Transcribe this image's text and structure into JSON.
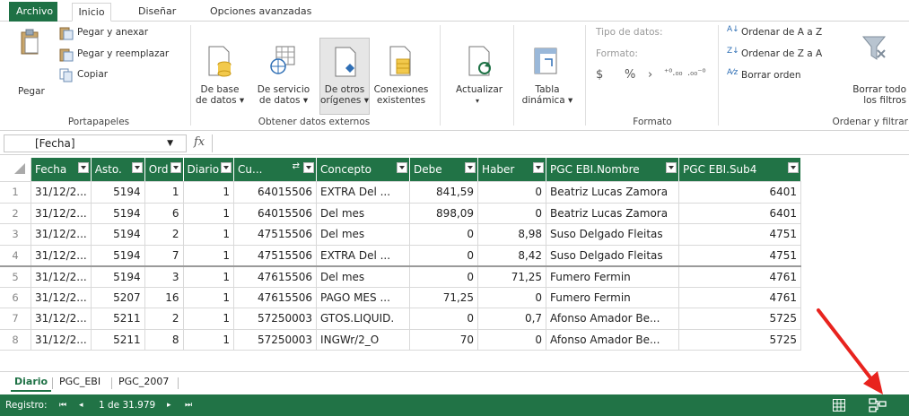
{
  "tabs": [
    "Archivo",
    "Inicio",
    "Diseñar",
    "Opciones avanzadas"
  ],
  "ribbon": {
    "clipboard": {
      "paste": "Pegar",
      "paste_append": "Pegar y anexar",
      "paste_replace": "Pegar y reemplazar",
      "copy": "Copiar",
      "group": "Portapapeles"
    },
    "external": {
      "from_db_1": "De base",
      "from_db_2": "de datos ▾",
      "from_service_1": "De servicio",
      "from_service_2": "de datos ▾",
      "from_other_1": "De otros",
      "from_other_2": "orígenes ▾",
      "existing_1": "Conexiones",
      "existing_2": "existentes",
      "group": "Obtener datos externos"
    },
    "refresh": {
      "label": "Actualizar",
      "caret": "▾"
    },
    "pivot": {
      "label_1": "Tabla",
      "label_2": "dinámica ▾"
    },
    "format": {
      "data_type": "Tipo de datos:",
      "format": "Formato:",
      "currency": "$",
      "percent": "%",
      "comma": "›",
      "dec_inc": "⁺⁰.₀₀",
      "dec_dec": ".₀₀⁻⁰",
      "group": "Formato"
    },
    "sort": {
      "asc": "Ordenar de A a Z",
      "desc": "Ordenar de Z a A",
      "clear": "Borrar orden",
      "clear_filters_1": "Borrar todo",
      "clear_filters_2": "los filtros",
      "group": "Ordenar y filtrar"
    }
  },
  "formula_bar": {
    "name_box": "[Fecha]",
    "fx": "fx"
  },
  "table": {
    "headers": [
      "Fecha",
      "Asto.",
      "Ord",
      "Diario",
      "Cu...",
      "Concepto",
      "Debe",
      "Haber",
      "PGC EBI.Nombre",
      "PGC EBI.Sub4"
    ],
    "rows": [
      [
        "1",
        "31/12/2...",
        "5194",
        "1",
        "1",
        "64015506",
        "EXTRA Del ...",
        "841,59",
        "0",
        "Beatriz Lucas Zamora",
        "6401"
      ],
      [
        "2",
        "31/12/2...",
        "5194",
        "6",
        "1",
        "64015506",
        "Del mes",
        "898,09",
        "0",
        "Beatriz Lucas Zamora",
        "6401"
      ],
      [
        "3",
        "31/12/2...",
        "5194",
        "2",
        "1",
        "47515506",
        "Del mes",
        "0",
        "8,98",
        "Suso Delgado Fleitas",
        "4751"
      ],
      [
        "4",
        "31/12/2...",
        "5194",
        "7",
        "1",
        "47515506",
        "EXTRA Del ...",
        "0",
        "8,42",
        "Suso Delgado Fleitas",
        "4751"
      ],
      [
        "5",
        "31/12/2...",
        "5194",
        "3",
        "1",
        "47615506",
        "Del mes",
        "0",
        "71,25",
        "Fumero Fermin",
        "4761"
      ],
      [
        "6",
        "31/12/2...",
        "5207",
        "16",
        "1",
        "47615506",
        "PAGO MES ...",
        "71,25",
        "0",
        "Fumero Fermin",
        "4761"
      ],
      [
        "7",
        "31/12/2...",
        "5211",
        "2",
        "1",
        "57250003",
        "GTOS.LIQUID.",
        "0",
        "0,7",
        "Afonso Amador Be...",
        "5725"
      ],
      [
        "8",
        "31/12/2...",
        "5211",
        "8",
        "1",
        "57250003",
        "INGWr/2_O",
        "70",
        "0",
        "Afonso Amador Be...",
        "5725"
      ]
    ]
  },
  "sheets": [
    "Diario",
    "PGC_EBI",
    "PGC_2007"
  ],
  "status": {
    "record_label": "Registro:",
    "first": "⏮",
    "prev": "◂",
    "position": "1 de 31.979",
    "next": "▸",
    "last": "⏭"
  },
  "colors": {
    "accent": "#217346",
    "arrow": "#e8231e"
  }
}
